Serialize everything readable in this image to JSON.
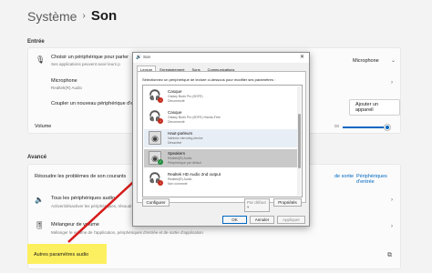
{
  "breadcrumb": {
    "parent": "Système",
    "sep": "›",
    "current": "Son"
  },
  "sections": {
    "output": "Entrée",
    "advanced": "Avancé"
  },
  "output_card": {
    "row1_title": "Choisir un périphérique pour parler",
    "row1_sub": "Ses applications peuvent avoir leurs p",
    "row1_value": "Microphone",
    "row2_title": "Microphone",
    "row2_sub": "Realtek(R) Audio",
    "row3_title": "Coupler un nouveau périphérique d'e",
    "row3_button": "Ajouter un appareil",
    "volume_label": "Volume",
    "volume_value": "00",
    "volume_level": 0.95
  },
  "advanced_card": {
    "troubleshoot": "Résoudre les problèmes de son courants",
    "troubleshoot_link1": "de sortie",
    "troubleshoot_link2": "Périphériques d'entrée",
    "devices_title": "Tous les périphériques audio",
    "devices_sub": "Activer/désactiver les périphériques, résoudre des problèmes,",
    "mixer_title": "Mélangeur de volume",
    "mixer_sub": "Mélanger le volume de l'application, périphériques d'entrée et de sortie d'application",
    "more_audio": "Autres paramètres audio",
    "external_icon": "external-link-icon"
  },
  "dialog": {
    "title": "Son",
    "tabs": [
      "Lecture",
      "Enregistrement",
      "Sons",
      "Communications"
    ],
    "instruction": "Sélectionnez un périphérique de lecture ci-dessous pour modifier ses paramètres :",
    "devices": [
      {
        "name": "Casque",
        "line1": "Galaxy Buds Pro (9DFE)",
        "line2": "Déconnecté",
        "icon": "headphones-icon",
        "status": "red"
      },
      {
        "name": "Casque",
        "line1": "Galaxy Buds Pro (9DFE) Hands-Free",
        "line2": "Déconnecté",
        "icon": "headphones-icon",
        "status": "red"
      },
      {
        "name": "Haut-parleurs",
        "line1": "Nahimic mirroring device",
        "line2": "Désactivé",
        "icon": "speaker-icon",
        "status": "none"
      },
      {
        "name": "Speakers",
        "line1": "Realtek(R) Audio",
        "line2": "Périphérique par défaut",
        "icon": "speaker-icon",
        "status": "green"
      },
      {
        "name": "Realtek HD Audio 2nd output",
        "line1": "Realtek(R) Audio",
        "line2": "Non connecté",
        "icon": "headphones-icon",
        "status": "red"
      }
    ],
    "configure": "Configurer",
    "default_select": "Par défaut",
    "properties": "Propriétés",
    "ok": "OK",
    "cancel": "Annuler",
    "apply": "Appliquer"
  },
  "colors": {
    "accent": "#0067c0",
    "highlight": "#fdf060",
    "arrow": "#d71a1a"
  }
}
